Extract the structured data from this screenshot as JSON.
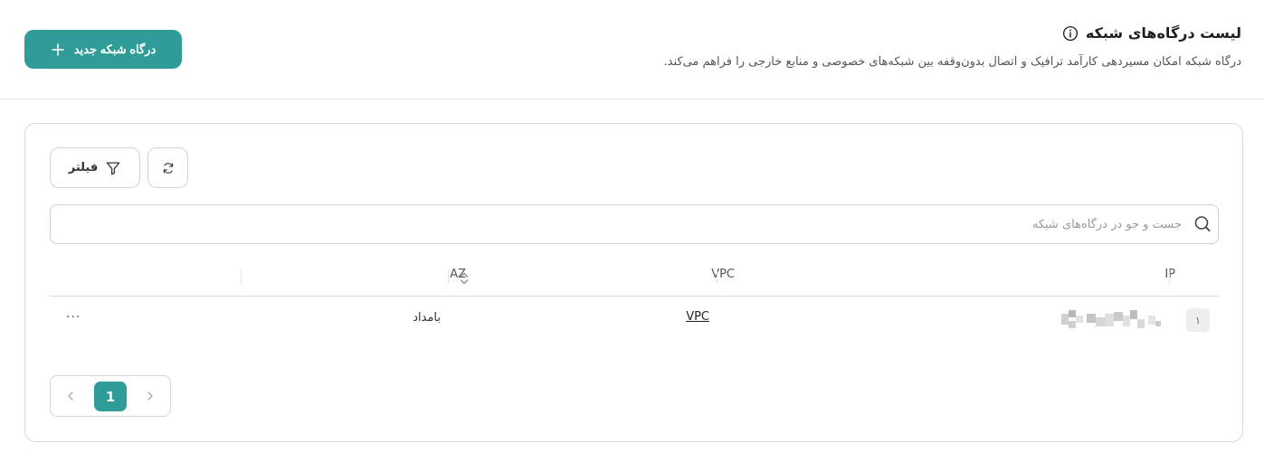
{
  "header": {
    "title": "لیست درگاه‌های شبکه",
    "description": "درگاه شبکه امکان مسیردهی کارآمد ترافیک و اتصال بدون‌وقفه بین شبکه‌های خصوصی و منابع خارجی را فراهم می‌کند.",
    "new_button_label": "درگاه شبکه جدید",
    "accent_color": "#2f9c97"
  },
  "toolbar": {
    "filter_label": "فیلتر",
    "refresh_icon": "refresh-icon",
    "filter_icon": "funnel-icon"
  },
  "search": {
    "placeholder": "جست و جو در درگاه‌های شبکه",
    "value": ""
  },
  "table": {
    "columns": [
      "IP",
      "VPC",
      "AZ"
    ],
    "rows": [
      {
        "index": "۱",
        "ip": "",
        "vpc": "VPC",
        "az": "بامداد",
        "actions": "..."
      }
    ]
  },
  "pagination": {
    "current_page": "1"
  }
}
